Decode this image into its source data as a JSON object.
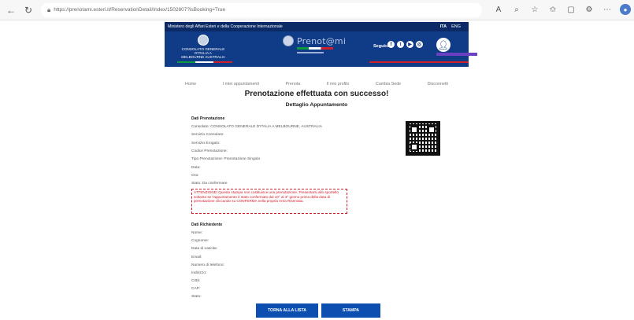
{
  "browser": {
    "url": "https://prenotami.esteri.it/ReservationDetail/Index/1502807?isBooking=True"
  },
  "topbar": {
    "ministry": "Ministero degli Affari Esteri e della Cooperazione Internazionale",
    "lang_it": "ITA",
    "lang_en": "ENG"
  },
  "header": {
    "consulate_line1": "CONSOLATO GENERALE D'ITALIA A",
    "consulate_line2": "MELBOURNE AUSTRALIA",
    "logo_text": "Prenot@mi",
    "seguici": "Seguici"
  },
  "nav": {
    "items": [
      "Home",
      "I miei appuntamenti",
      "Prenota",
      "Il mio profilo",
      "Cambia Sede",
      "Disconnetti"
    ]
  },
  "main": {
    "title": "Prenotazione effettuata con successo!",
    "subtitle": "Dettaglio Appuntamento",
    "booking_section": "Dati Prenotazione",
    "booking_fields": [
      "Consolato: CONSOLATO GENERALE D'ITALIA A MELBOURNE, AUSTRALIA",
      "Servizio Consolare:",
      "Servizio Erogato:",
      "Codice Prenotazione:",
      "Tipo Prenotazione: Prenotazione Singola",
      "Data:",
      "Ora:",
      "Stato: Da confermare"
    ],
    "warning_text": "ATTENZIONE! Questa stampa non costituisce una prenotazione. Presentarsi allo sportello soltanto se l'appuntamento è stato confermato dal 10° al 3° giorno prima della data di prenotazione cliccando su CONFERMA nella propria Area Riservata.",
    "applicant_section": "Dati Richiedente",
    "applicant_fields": [
      "Nome:",
      "Cognome:",
      "Data di nascita:",
      "Email:",
      "Numero di telefono:",
      "Indirizzo:",
      "Città:",
      "CAP:",
      "Stato:"
    ],
    "btn_back": "TORNA ALLA LISTA",
    "btn_print": "STAMPA"
  }
}
